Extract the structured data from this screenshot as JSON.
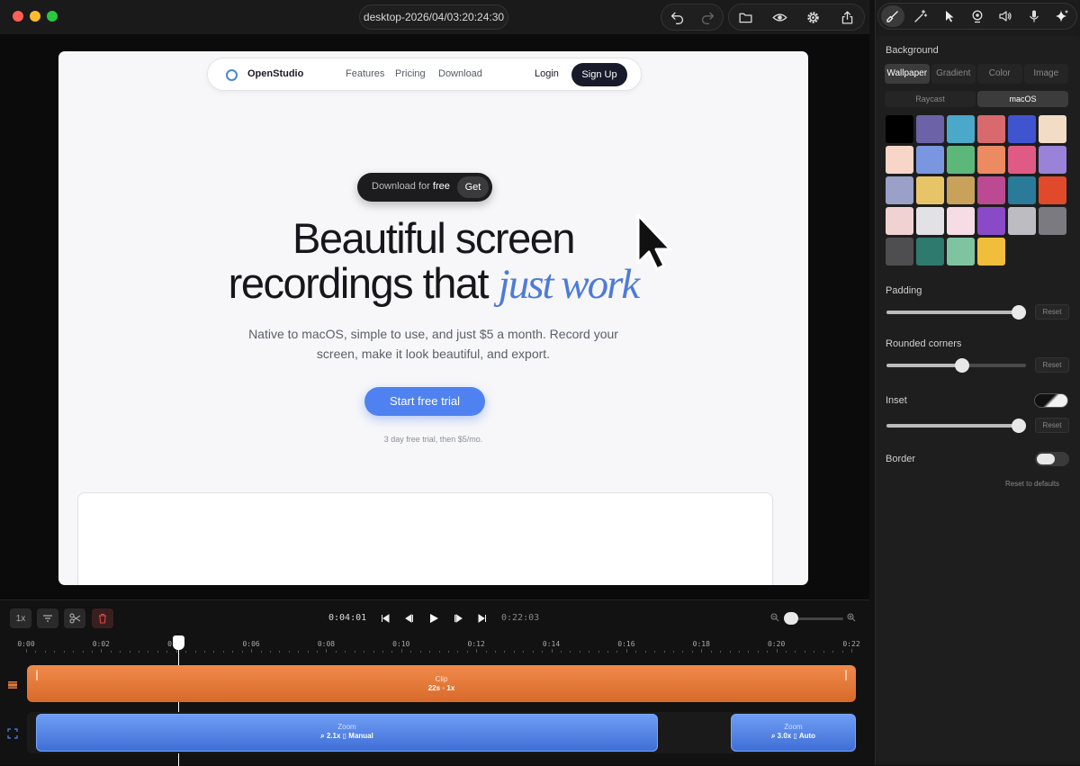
{
  "window": {
    "title": "desktop-2026/04/03:20:24:30"
  },
  "preview": {
    "nav": {
      "brand": "OpenStudio",
      "links": [
        "Features",
        "Pricing",
        "Download"
      ],
      "login": "Login",
      "signup": "Sign Up"
    },
    "pill": {
      "text": "Download for",
      "emphasis": "free",
      "button": "Get"
    },
    "hero": {
      "line1": "Beautiful screen",
      "line2": "recordings that",
      "accent": "just work"
    },
    "subtitle": {
      "line1": "Native to macOS, simple to use, and just $5 a month. Record your",
      "line2": "screen, make it look beautiful, and export."
    },
    "cta": "Start free trial",
    "fine_print": "3 day free trial, then $5/mo."
  },
  "panel": {
    "background_label": "Background",
    "bg_tabs": [
      "Wallpaper",
      "Gradient",
      "Color",
      "Image"
    ],
    "bg_active": "Wallpaper",
    "sub_tabs": [
      "Raycast",
      "macOS"
    ],
    "sub_active": "macOS",
    "padding_label": "Padding",
    "padding_value": 0.95,
    "corners_label": "Rounded corners",
    "corners_value": 0.54,
    "inset_label": "Inset",
    "inset_value": 0.95,
    "inset_toggle": true,
    "border_label": "Border",
    "border_toggle": false,
    "reset": "Reset",
    "reset_all": "Reset to defaults",
    "swatch_colors": [
      "#000000",
      "#6b62a8",
      "#4aa8c8",
      "#d86a6e",
      "#4054d0",
      "#f2dcc6",
      "#f7d6c8",
      "#7a96e0",
      "#5cb87a",
      "#ec8a62",
      "#e05a86",
      "#9a82d8",
      "#9aa0c8",
      "#e8c468",
      "#c8a25a",
      "#bb4a92",
      "#2a7a9a",
      "#e04a2a",
      "#f0d2d2",
      "#e2e2e6",
      "#f6dce4",
      "#8a4ac8",
      "#bcbcc2",
      "#7a7a80",
      "#4e4e50",
      "#2e7a6e",
      "#7ec4a0",
      "#f0be3a"
    ]
  },
  "timeline": {
    "speed": "1x",
    "current": "0:04:01",
    "total": "0:22:03",
    "ticks": [
      "0:00",
      "0:02",
      "0:04",
      "0:06",
      "0:08",
      "0:10",
      "0:12",
      "0:14",
      "0:16",
      "0:18",
      "0:20",
      "0:22"
    ],
    "clip": {
      "label": "Clip",
      "detail": "22s ◦ 1x"
    },
    "zooms": [
      {
        "label": "Zoom",
        "level": "2.1x",
        "mode": "Manual"
      },
      {
        "label": "Zoom",
        "level": "3.0x",
        "mode": "Auto"
      }
    ]
  }
}
